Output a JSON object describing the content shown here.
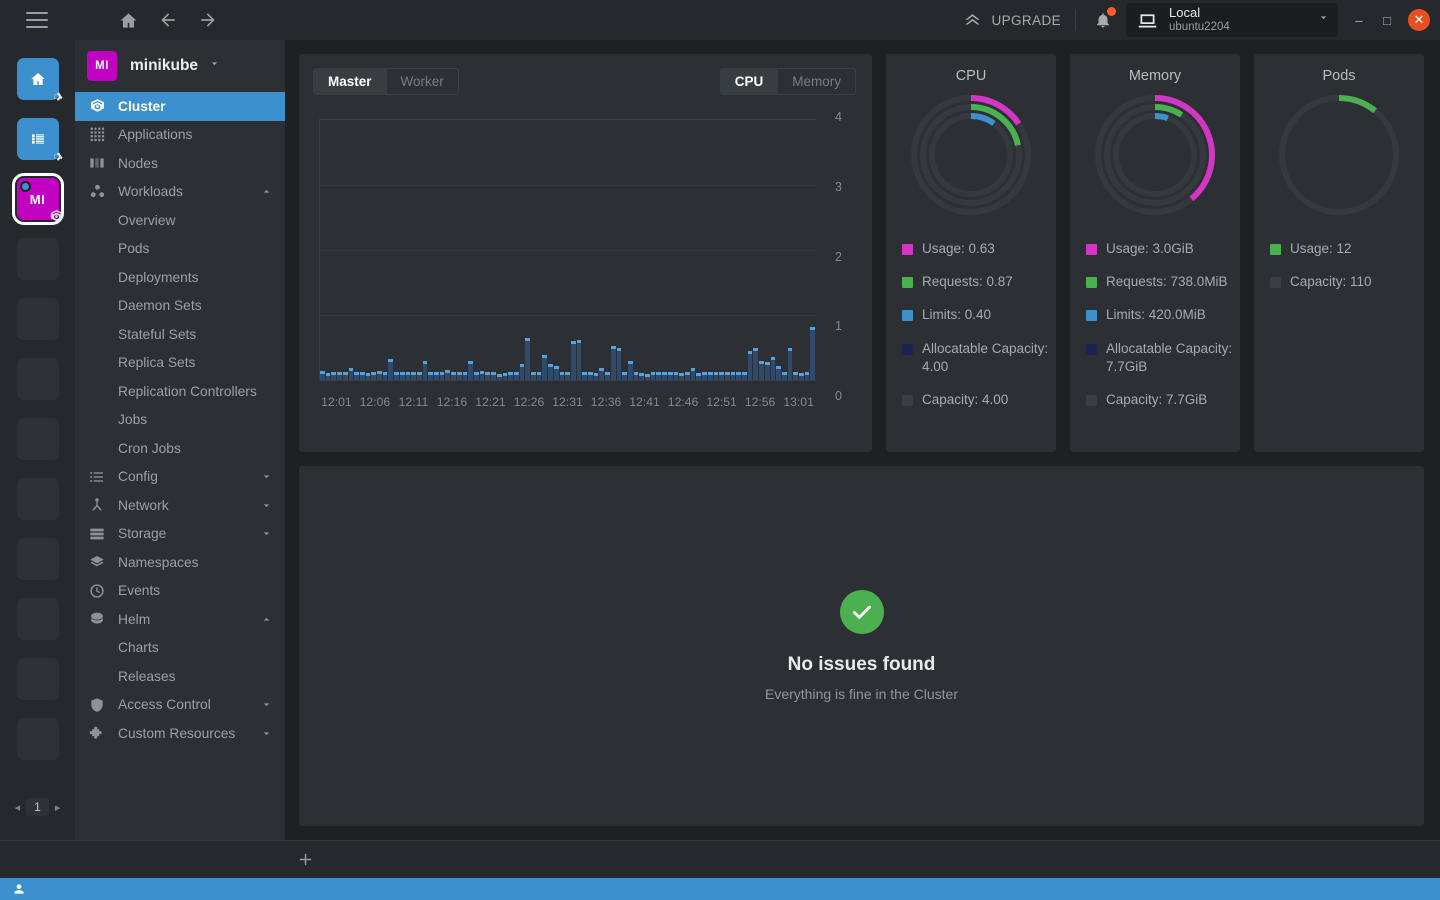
{
  "titlebar": {
    "menu_icon": "hamburger-icon",
    "home_icon": "home-icon",
    "back_icon": "arrow-left-icon",
    "forward_icon": "arrow-right-icon",
    "upgrade_label": "UPGRADE",
    "notifications_icon": "bell-icon",
    "cluster_pill": {
      "icon": "laptop-icon",
      "name": "Local",
      "subtitle": "ubuntu2204",
      "caret": "chevron-down-icon"
    },
    "minimize_label": "–",
    "maximize_label": "□",
    "close_label": "✕"
  },
  "rail": {
    "items": [
      {
        "type": "blue",
        "icon": "home-icon",
        "label": "",
        "badge": "gear-icon",
        "active": false
      },
      {
        "type": "blue",
        "icon": "list-icon",
        "label": "",
        "badge": "gear-icon",
        "active": false
      },
      {
        "type": "magenta",
        "icon": "",
        "label": "MI",
        "badge": "kubernetes-icon",
        "active": true
      },
      {
        "type": "empty",
        "icon": "",
        "label": "",
        "badge": "",
        "active": false
      },
      {
        "type": "empty",
        "icon": "",
        "label": "",
        "badge": "",
        "active": false
      },
      {
        "type": "empty",
        "icon": "",
        "label": "",
        "badge": "",
        "active": false
      },
      {
        "type": "empty",
        "icon": "",
        "label": "",
        "badge": "",
        "active": false
      },
      {
        "type": "empty",
        "icon": "",
        "label": "",
        "badge": "",
        "active": false
      },
      {
        "type": "empty",
        "icon": "",
        "label": "",
        "badge": "",
        "active": false
      },
      {
        "type": "empty",
        "icon": "",
        "label": "",
        "badge": "",
        "active": false
      },
      {
        "type": "empty",
        "icon": "",
        "label": "",
        "badge": "",
        "active": false
      },
      {
        "type": "empty",
        "icon": "",
        "label": "",
        "badge": "",
        "active": false
      }
    ],
    "pager": {
      "prev": "◂",
      "page": "1",
      "next": "▸"
    }
  },
  "sidebar": {
    "context": {
      "avatar": "MI",
      "name": "minikube",
      "caret": "chevron-down-icon"
    },
    "items": [
      {
        "label": "Cluster",
        "icon": "kubernetes-icon",
        "selected": true,
        "kind": "item"
      },
      {
        "label": "Applications",
        "icon": "grid-icon",
        "selected": false,
        "kind": "item"
      },
      {
        "label": "Nodes",
        "icon": "server-icon",
        "selected": false,
        "kind": "item"
      },
      {
        "label": "Workloads",
        "icon": "workloads-icon",
        "selected": false,
        "kind": "group",
        "caret": "chevron-up-icon"
      },
      {
        "label": "Overview",
        "kind": "sub"
      },
      {
        "label": "Pods",
        "kind": "sub"
      },
      {
        "label": "Deployments",
        "kind": "sub"
      },
      {
        "label": "Daemon Sets",
        "kind": "sub"
      },
      {
        "label": "Stateful Sets",
        "kind": "sub"
      },
      {
        "label": "Replica Sets",
        "kind": "sub"
      },
      {
        "label": "Replication Controllers",
        "kind": "sub"
      },
      {
        "label": "Jobs",
        "kind": "sub"
      },
      {
        "label": "Cron Jobs",
        "kind": "sub"
      },
      {
        "label": "Config",
        "icon": "config-icon",
        "selected": false,
        "kind": "group",
        "caret": "chevron-down-icon"
      },
      {
        "label": "Network",
        "icon": "network-icon",
        "selected": false,
        "kind": "group",
        "caret": "chevron-down-icon"
      },
      {
        "label": "Storage",
        "icon": "storage-icon",
        "selected": false,
        "kind": "group",
        "caret": "chevron-down-icon"
      },
      {
        "label": "Namespaces",
        "icon": "layers-icon",
        "selected": false,
        "kind": "item"
      },
      {
        "label": "Events",
        "icon": "clock-icon",
        "selected": false,
        "kind": "item"
      },
      {
        "label": "Helm",
        "icon": "helm-icon",
        "selected": false,
        "kind": "group",
        "caret": "chevron-up-icon"
      },
      {
        "label": "Charts",
        "kind": "sub"
      },
      {
        "label": "Releases",
        "kind": "sub"
      },
      {
        "label": "Access Control",
        "icon": "shield-icon",
        "selected": false,
        "kind": "group",
        "caret": "chevron-down-icon"
      },
      {
        "label": "Custom Resources",
        "icon": "puzzle-icon",
        "selected": false,
        "kind": "group",
        "caret": "chevron-down-icon"
      }
    ]
  },
  "main": {
    "node_tabs": [
      {
        "label": "Master",
        "active": true
      },
      {
        "label": "Worker",
        "active": false
      }
    ],
    "metric_tabs": [
      {
        "label": "CPU",
        "active": true
      },
      {
        "label": "Memory",
        "active": false
      }
    ],
    "events": {
      "icon": "check-circle-icon",
      "title": "No issues found",
      "subtitle": "Everything is fine in the Cluster"
    }
  },
  "bottombar": {
    "add_tab_icon": "plus-icon"
  },
  "statusbar": {
    "user_icon": "user-icon"
  },
  "colors": {
    "usage": "#d335c4",
    "requests": "#4caf50",
    "limits": "#3d90ce",
    "allocatable": "#1e2250",
    "capacity": "#3a3f44",
    "accent": "#3d90ce",
    "bar": "#53a3e0",
    "bar_body": "#2f4a6b",
    "ok": "#4caf50"
  },
  "chart_data": [
    {
      "type": "bar",
      "title": "CPU",
      "xlabel": "",
      "ylabel": "",
      "ylim": [
        0,
        4
      ],
      "yticks": [
        0,
        1,
        2,
        3,
        4
      ],
      "grid": true,
      "x": [
        "12:01",
        "12:06",
        "12:11",
        "12:16",
        "12:21",
        "12:26",
        "12:31",
        "12:36",
        "12:41",
        "12:46",
        "12:51",
        "12:56",
        "13:01"
      ],
      "xtick_labels": [
        "12:01",
        "12:06",
        "12:11",
        "12:16",
        "12:21",
        "12:26",
        "12:31",
        "12:36",
        "12:41",
        "12:46",
        "12:51",
        "12:56",
        "13:01"
      ],
      "values": [
        0.14,
        0.11,
        0.12,
        0.12,
        0.12,
        0.18,
        0.13,
        0.12,
        0.11,
        0.12,
        0.14,
        0.13,
        0.33,
        0.13,
        0.12,
        0.12,
        0.13,
        0.12,
        0.3,
        0.13,
        0.12,
        0.13,
        0.15,
        0.12,
        0.12,
        0.13,
        0.3,
        0.13,
        0.14,
        0.12,
        0.12,
        0.1,
        0.11,
        0.12,
        0.13,
        0.24,
        0.65,
        0.13,
        0.12,
        0.38,
        0.24,
        0.22,
        0.12,
        0.13,
        0.6,
        0.62,
        0.13,
        0.12,
        0.11,
        0.18,
        0.13,
        0.52,
        0.5,
        0.13,
        0.3,
        0.12,
        0.11,
        0.1,
        0.12,
        0.13,
        0.12,
        0.13,
        0.12,
        0.11,
        0.12,
        0.18,
        0.11,
        0.12,
        0.13,
        0.12,
        0.13,
        0.13,
        0.12,
        0.12,
        0.12,
        0.45,
        0.5,
        0.3,
        0.28,
        0.36,
        0.22,
        0.13,
        0.5,
        0.13,
        0.11,
        0.12,
        0.82
      ]
    },
    {
      "type": "pie",
      "title": "CPU",
      "legend_position": "bottom",
      "rings": [
        {
          "name": "Usage",
          "label": "Usage: 0.63",
          "value": 0.63,
          "max": 4.0,
          "color": "#d335c4"
        },
        {
          "name": "Requests",
          "label": "Requests: 0.87",
          "value": 0.87,
          "max": 4.0,
          "color": "#4caf50"
        },
        {
          "name": "Limits",
          "label": "Limits: 0.40",
          "value": 0.4,
          "max": 4.0,
          "color": "#3d90ce"
        }
      ],
      "extra_legend": [
        {
          "label": "Allocatable Capacity: 4.00",
          "color": "#1e2250"
        },
        {
          "label": "Capacity: 4.00",
          "color": "#3a3f44"
        }
      ]
    },
    {
      "type": "pie",
      "title": "Memory",
      "legend_position": "bottom",
      "rings": [
        {
          "name": "Usage",
          "label": "Usage: 3.0GiB",
          "value": 3.0,
          "max": 7.7,
          "color": "#d335c4"
        },
        {
          "name": "Requests",
          "label": "Requests: 738.0MiB",
          "value": 0.72,
          "max": 7.7,
          "color": "#4caf50"
        },
        {
          "name": "Limits",
          "label": "Limits: 420.0MiB",
          "value": 0.41,
          "max": 7.7,
          "color": "#3d90ce"
        }
      ],
      "extra_legend": [
        {
          "label": "Allocatable Capacity: 7.7GiB",
          "color": "#1e2250"
        },
        {
          "label": "Capacity: 7.7GiB",
          "color": "#3a3f44"
        }
      ]
    },
    {
      "type": "pie",
      "title": "Pods",
      "legend_position": "bottom",
      "rings": [
        {
          "name": "Usage",
          "label": "Usage: 12",
          "value": 12,
          "max": 110,
          "color": "#4caf50"
        }
      ],
      "extra_legend": [
        {
          "label": "Capacity: 110",
          "color": "#3a3f44"
        }
      ]
    }
  ]
}
